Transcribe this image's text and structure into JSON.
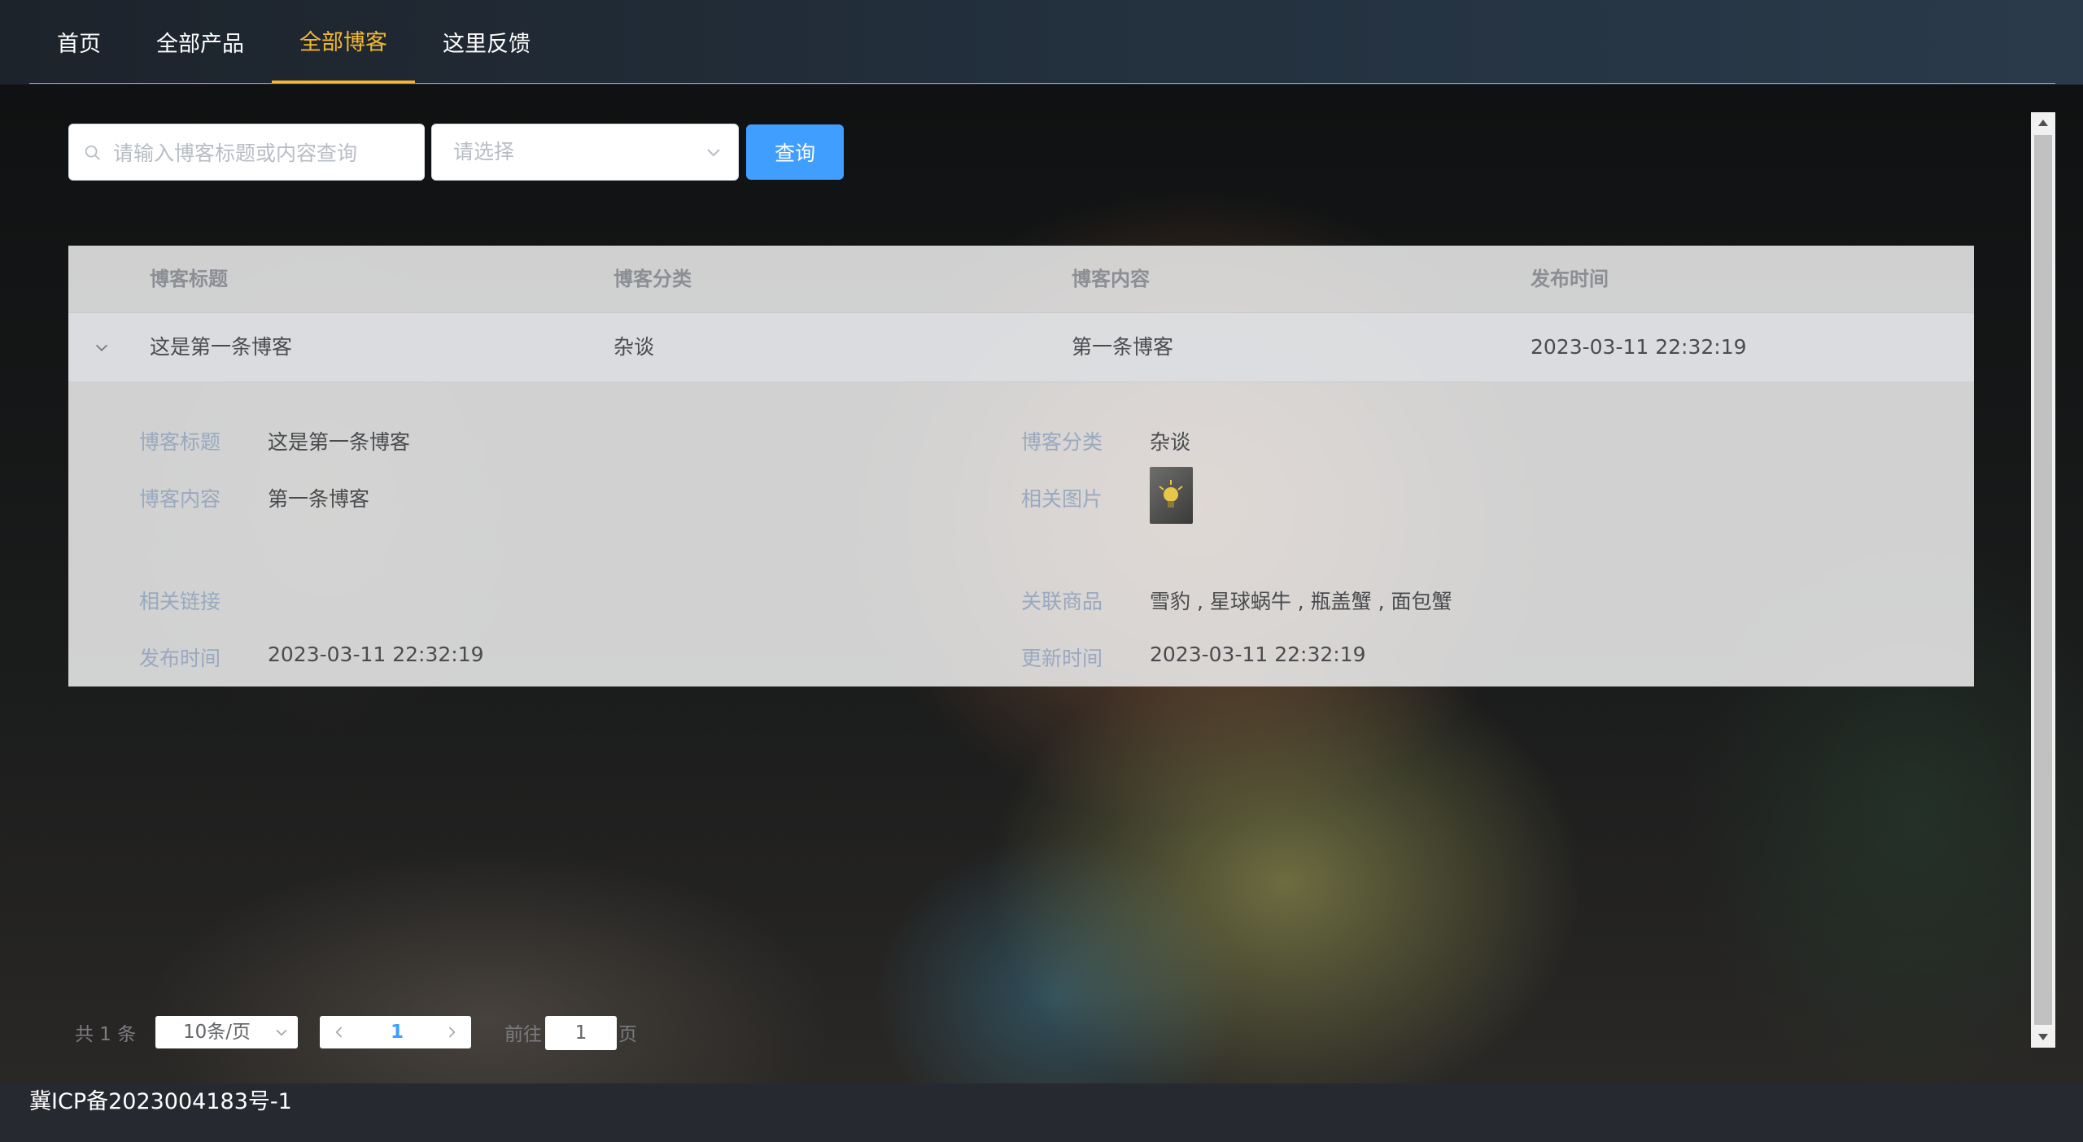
{
  "nav": {
    "items": [
      {
        "label": "首页"
      },
      {
        "label": "全部产品"
      },
      {
        "label": "全部博客",
        "active": true
      },
      {
        "label": "这里反馈"
      }
    ]
  },
  "filters": {
    "search_placeholder": "请输入博客标题或内容查询",
    "select_placeholder": "请选择",
    "query_button": "查询"
  },
  "table": {
    "columns": [
      "博客标题",
      "博客分类",
      "博客内容",
      "发布时间"
    ],
    "rows": [
      {
        "title": "这是第一条博客",
        "category": "杂谈",
        "content": "第一条博客",
        "published": "2023-03-11 22:32:19"
      }
    ],
    "detail": {
      "title_label": "博客标题",
      "title_value": "这是第一条博客",
      "category_label": "博客分类",
      "category_value": "杂谈",
      "content_label": "博客内容",
      "content_value": "第一条博客",
      "image_label": "相关图片",
      "link_label": "相关链接",
      "link_value": "",
      "products_label": "关联商品",
      "products_value": "雪豹 , 星球蜗牛 , 瓶盖蟹 , 面包蟹",
      "published_label": "发布时间",
      "published_value": "2023-03-11 22:32:19",
      "updated_label": "更新时间",
      "updated_value": "2023-03-11 22:32:19"
    }
  },
  "pagination": {
    "total": "共 1 条",
    "page_size": "10条/页",
    "current_page": "1",
    "goto_label": "前往",
    "goto_value": "1",
    "page_suffix": "页"
  },
  "footer": {
    "icp": "冀ICP备2023004183号-1"
  },
  "colors": {
    "accent": "#f2b733",
    "primary": "#409eff"
  }
}
